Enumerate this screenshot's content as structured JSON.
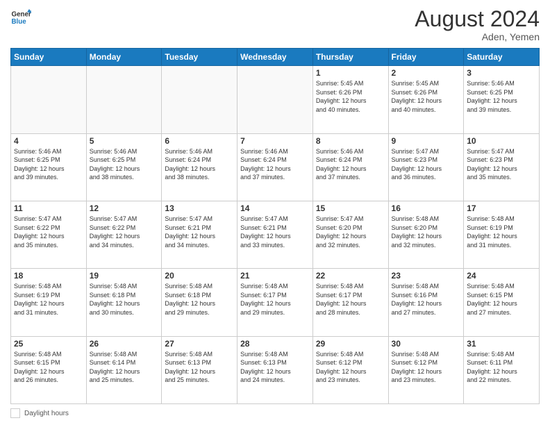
{
  "header": {
    "logo_general": "General",
    "logo_blue": "Blue",
    "month_year": "August 2024",
    "location": "Aden, Yemen"
  },
  "days_of_week": [
    "Sunday",
    "Monday",
    "Tuesday",
    "Wednesday",
    "Thursday",
    "Friday",
    "Saturday"
  ],
  "footer": {
    "label": "Daylight hours"
  },
  "weeks": [
    [
      {
        "day": "",
        "info": ""
      },
      {
        "day": "",
        "info": ""
      },
      {
        "day": "",
        "info": ""
      },
      {
        "day": "",
        "info": ""
      },
      {
        "day": "1",
        "info": "Sunrise: 5:45 AM\nSunset: 6:26 PM\nDaylight: 12 hours\nand 40 minutes."
      },
      {
        "day": "2",
        "info": "Sunrise: 5:45 AM\nSunset: 6:26 PM\nDaylight: 12 hours\nand 40 minutes."
      },
      {
        "day": "3",
        "info": "Sunrise: 5:46 AM\nSunset: 6:25 PM\nDaylight: 12 hours\nand 39 minutes."
      }
    ],
    [
      {
        "day": "4",
        "info": "Sunrise: 5:46 AM\nSunset: 6:25 PM\nDaylight: 12 hours\nand 39 minutes."
      },
      {
        "day": "5",
        "info": "Sunrise: 5:46 AM\nSunset: 6:25 PM\nDaylight: 12 hours\nand 38 minutes."
      },
      {
        "day": "6",
        "info": "Sunrise: 5:46 AM\nSunset: 6:24 PM\nDaylight: 12 hours\nand 38 minutes."
      },
      {
        "day": "7",
        "info": "Sunrise: 5:46 AM\nSunset: 6:24 PM\nDaylight: 12 hours\nand 37 minutes."
      },
      {
        "day": "8",
        "info": "Sunrise: 5:46 AM\nSunset: 6:24 PM\nDaylight: 12 hours\nand 37 minutes."
      },
      {
        "day": "9",
        "info": "Sunrise: 5:47 AM\nSunset: 6:23 PM\nDaylight: 12 hours\nand 36 minutes."
      },
      {
        "day": "10",
        "info": "Sunrise: 5:47 AM\nSunset: 6:23 PM\nDaylight: 12 hours\nand 35 minutes."
      }
    ],
    [
      {
        "day": "11",
        "info": "Sunrise: 5:47 AM\nSunset: 6:22 PM\nDaylight: 12 hours\nand 35 minutes."
      },
      {
        "day": "12",
        "info": "Sunrise: 5:47 AM\nSunset: 6:22 PM\nDaylight: 12 hours\nand 34 minutes."
      },
      {
        "day": "13",
        "info": "Sunrise: 5:47 AM\nSunset: 6:21 PM\nDaylight: 12 hours\nand 34 minutes."
      },
      {
        "day": "14",
        "info": "Sunrise: 5:47 AM\nSunset: 6:21 PM\nDaylight: 12 hours\nand 33 minutes."
      },
      {
        "day": "15",
        "info": "Sunrise: 5:47 AM\nSunset: 6:20 PM\nDaylight: 12 hours\nand 32 minutes."
      },
      {
        "day": "16",
        "info": "Sunrise: 5:48 AM\nSunset: 6:20 PM\nDaylight: 12 hours\nand 32 minutes."
      },
      {
        "day": "17",
        "info": "Sunrise: 5:48 AM\nSunset: 6:19 PM\nDaylight: 12 hours\nand 31 minutes."
      }
    ],
    [
      {
        "day": "18",
        "info": "Sunrise: 5:48 AM\nSunset: 6:19 PM\nDaylight: 12 hours\nand 31 minutes."
      },
      {
        "day": "19",
        "info": "Sunrise: 5:48 AM\nSunset: 6:18 PM\nDaylight: 12 hours\nand 30 minutes."
      },
      {
        "day": "20",
        "info": "Sunrise: 5:48 AM\nSunset: 6:18 PM\nDaylight: 12 hours\nand 29 minutes."
      },
      {
        "day": "21",
        "info": "Sunrise: 5:48 AM\nSunset: 6:17 PM\nDaylight: 12 hours\nand 29 minutes."
      },
      {
        "day": "22",
        "info": "Sunrise: 5:48 AM\nSunset: 6:17 PM\nDaylight: 12 hours\nand 28 minutes."
      },
      {
        "day": "23",
        "info": "Sunrise: 5:48 AM\nSunset: 6:16 PM\nDaylight: 12 hours\nand 27 minutes."
      },
      {
        "day": "24",
        "info": "Sunrise: 5:48 AM\nSunset: 6:15 PM\nDaylight: 12 hours\nand 27 minutes."
      }
    ],
    [
      {
        "day": "25",
        "info": "Sunrise: 5:48 AM\nSunset: 6:15 PM\nDaylight: 12 hours\nand 26 minutes."
      },
      {
        "day": "26",
        "info": "Sunrise: 5:48 AM\nSunset: 6:14 PM\nDaylight: 12 hours\nand 25 minutes."
      },
      {
        "day": "27",
        "info": "Sunrise: 5:48 AM\nSunset: 6:13 PM\nDaylight: 12 hours\nand 25 minutes."
      },
      {
        "day": "28",
        "info": "Sunrise: 5:48 AM\nSunset: 6:13 PM\nDaylight: 12 hours\nand 24 minutes."
      },
      {
        "day": "29",
        "info": "Sunrise: 5:48 AM\nSunset: 6:12 PM\nDaylight: 12 hours\nand 23 minutes."
      },
      {
        "day": "30",
        "info": "Sunrise: 5:48 AM\nSunset: 6:12 PM\nDaylight: 12 hours\nand 23 minutes."
      },
      {
        "day": "31",
        "info": "Sunrise: 5:48 AM\nSunset: 6:11 PM\nDaylight: 12 hours\nand 22 minutes."
      }
    ]
  ]
}
